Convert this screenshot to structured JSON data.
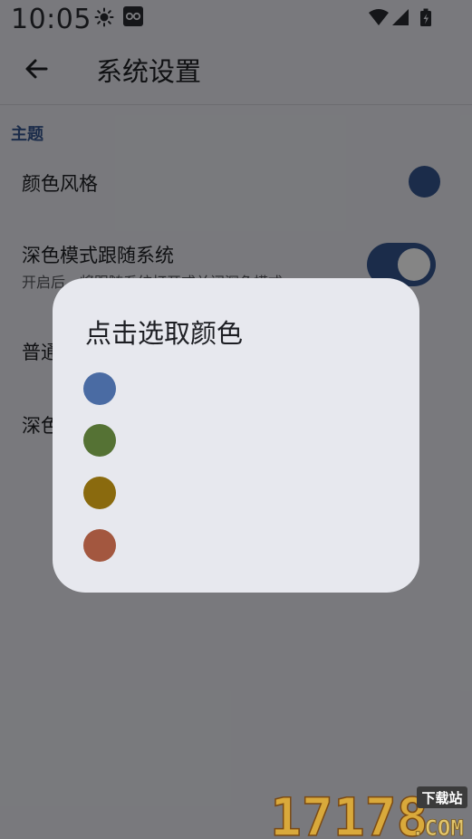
{
  "status_bar": {
    "time": "10:05"
  },
  "app_bar": {
    "title": "系统设置"
  },
  "settings": {
    "section_title": "主题",
    "color_style_label": "颜色风格",
    "dark_follow_label": "深色模式跟随系统",
    "dark_follow_sub": "开启后，将跟随系统打开或关闭深色模式",
    "normal_mode_label": "普通模式",
    "dark_mode_label": "深色模式",
    "dark_follow_enabled": true,
    "accent_color": "#34558f"
  },
  "dialog": {
    "title": "点击选取颜色",
    "colors": [
      "#4a6ba3",
      "#557234",
      "#8a6a0e",
      "#a3573f"
    ]
  },
  "watermark": {
    "digits": "17178",
    "tag": "下载站",
    "domain": ".COM"
  }
}
